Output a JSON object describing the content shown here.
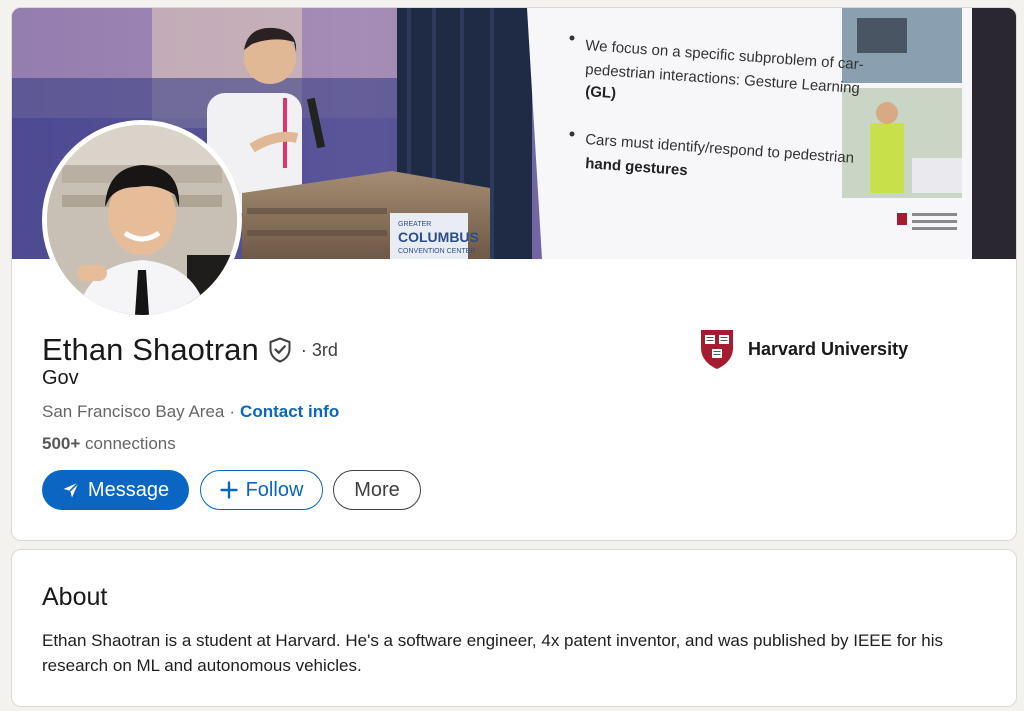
{
  "profile": {
    "name": "Ethan Shaotran",
    "degree": "· 3rd",
    "headline": "Gov",
    "location": "San Francisco Bay Area",
    "location_sep": "·",
    "contact_info": "Contact info",
    "connections_count": "500+",
    "connections_label": "connections"
  },
  "cover": {
    "slide_bullet_1": "We focus on a specific subproblem of car-pedestrian interactions: Gesture Learning (GL)",
    "slide_bullet_2": "Cars must identify/respond to pedestrian hand gestures",
    "podium_sign_1": "GREATER",
    "podium_sign_2": "COLUMBUS",
    "podium_sign_3": "CONVENTION CENTER"
  },
  "actions": {
    "message": "Message",
    "follow": "Follow",
    "more": "More"
  },
  "education": {
    "school": "Harvard University"
  },
  "about": {
    "title": "About",
    "text": "Ethan Shaotran is a student at Harvard. He's a software engineer, 4x patent inventor, and was published by IEEE for his research on ML and autonomous vehicles."
  },
  "icons": {
    "verified": "shield-check-icon",
    "message": "send-icon",
    "follow": "plus-icon",
    "school": "harvard-shield-icon"
  },
  "colors": {
    "brand_blue": "#0a66c2",
    "harvard_crimson": "#a51c30",
    "page_bg": "#f4f2ee"
  }
}
